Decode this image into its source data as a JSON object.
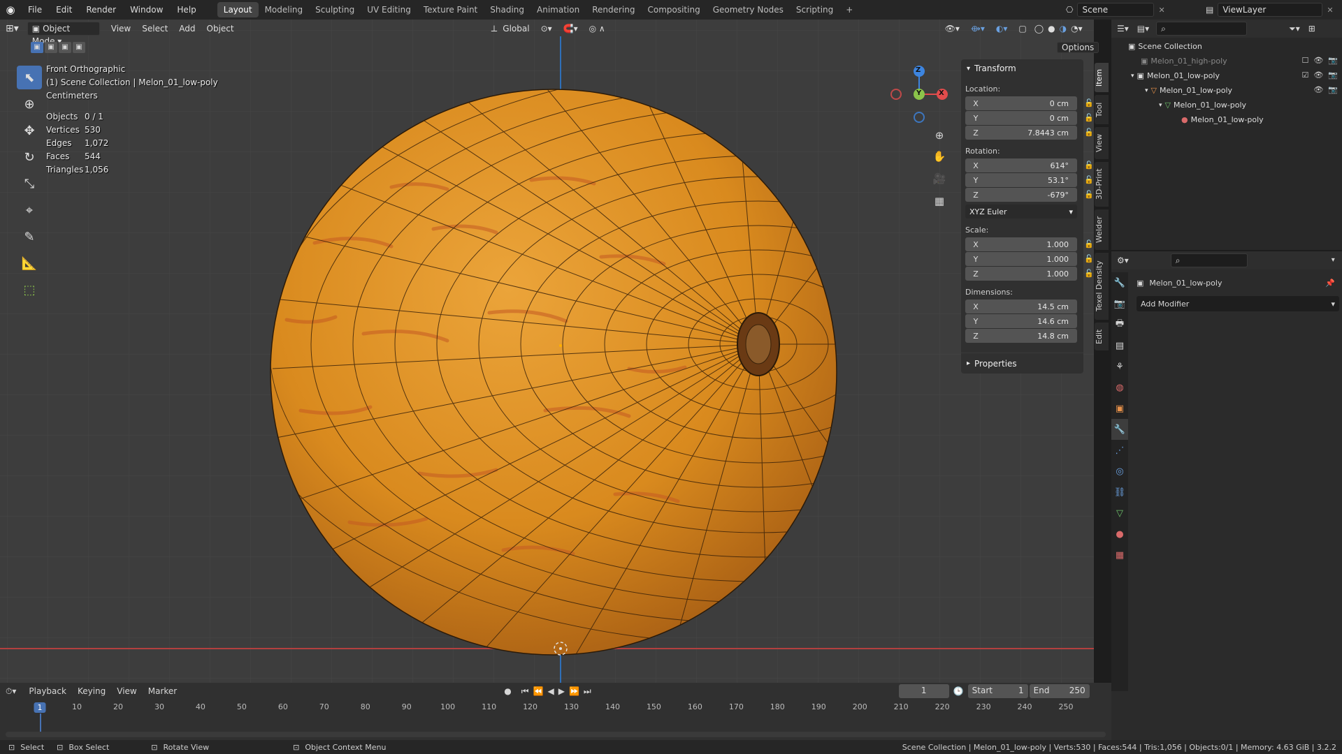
{
  "topbar": {
    "menus": [
      "File",
      "Edit",
      "Render",
      "Window",
      "Help"
    ],
    "workspaces": [
      "Layout",
      "Modeling",
      "Sculpting",
      "UV Editing",
      "Texture Paint",
      "Shading",
      "Animation",
      "Rendering",
      "Compositing",
      "Geometry Nodes",
      "Scripting"
    ],
    "active_workspace": "Layout",
    "add_tab": "+",
    "scene_name": "Scene",
    "view_layer": "ViewLayer"
  },
  "viewport_header": {
    "mode": "Object Mode",
    "menus": [
      "View",
      "Select",
      "Add",
      "Object"
    ],
    "transform_orientation": "Global",
    "options_label": "Options"
  },
  "overlay": {
    "view_name": "Front Orthographic",
    "collection_line": "(1) Scene Collection | Melon_01_low-poly",
    "units": "Centimeters",
    "stats": [
      {
        "key": "Objects",
        "value": "0 / 1"
      },
      {
        "key": "Vertices",
        "value": "530"
      },
      {
        "key": "Edges",
        "value": "1,072"
      },
      {
        "key": "Faces",
        "value": "544"
      },
      {
        "key": "Triangles",
        "value": "1,056"
      }
    ]
  },
  "gizmo": {
    "x": "X",
    "y": "Y",
    "z": "Z"
  },
  "npanel": {
    "transform_title": "Transform",
    "location_label": "Location:",
    "location": [
      {
        "axis": "X",
        "value": "0 cm"
      },
      {
        "axis": "Y",
        "value": "0 cm"
      },
      {
        "axis": "Z",
        "value": "7.8443 cm"
      }
    ],
    "rotation_label": "Rotation:",
    "rotation": [
      {
        "axis": "X",
        "value": "614°"
      },
      {
        "axis": "Y",
        "value": "53.1°"
      },
      {
        "axis": "Z",
        "value": "-679°"
      }
    ],
    "rotation_mode": "XYZ Euler",
    "scale_label": "Scale:",
    "scale": [
      {
        "axis": "X",
        "value": "1.000"
      },
      {
        "axis": "Y",
        "value": "1.000"
      },
      {
        "axis": "Z",
        "value": "1.000"
      }
    ],
    "dimensions_label": "Dimensions:",
    "dimensions": [
      {
        "axis": "X",
        "value": "14.5 cm"
      },
      {
        "axis": "Y",
        "value": "14.6 cm"
      },
      {
        "axis": "Z",
        "value": "14.8 cm"
      }
    ],
    "properties_title": "Properties"
  },
  "side_tabs": [
    "Item",
    "Tool",
    "View",
    "3D-Print",
    "Welder",
    "Texel Density",
    "Edit"
  ],
  "outliner": {
    "rows": [
      {
        "name": "Scene Collection",
        "indent": 0
      },
      {
        "name": "Melon_01_high-poly",
        "indent": 1
      },
      {
        "name": "Melon_01_low-poly",
        "indent": 1
      },
      {
        "name": "Melon_01_low-poly",
        "indent": 2
      },
      {
        "name": "Melon_01_low-poly",
        "indent": 3
      },
      {
        "name": "Melon_01_low-poly",
        "indent": 4
      }
    ]
  },
  "properties": {
    "object_name": "Melon_01_low-poly",
    "add_modifier": "Add Modifier"
  },
  "timeline": {
    "menus": [
      "Playback",
      "Keying",
      "View",
      "Marker"
    ],
    "current_frame": "1",
    "start_label": "Start",
    "start_value": "1",
    "end_label": "End",
    "end_value": "250",
    "ticks": [
      "1",
      "10",
      "20",
      "30",
      "40",
      "50",
      "60",
      "70",
      "80",
      "90",
      "100",
      "110",
      "120",
      "130",
      "140",
      "150",
      "160",
      "170",
      "180",
      "190",
      "200",
      "210",
      "220",
      "230",
      "240",
      "250"
    ]
  },
  "statusbar": {
    "select": "Select",
    "box_select": "Box Select",
    "rotate_view": "Rotate View",
    "context_menu": "Object Context Menu",
    "info": "Scene Collection | Melon_01_low-poly | Verts:530 | Faces:544 | Tris:1,056 | Objects:0/1 | Memory: 4.63 GiB | 3.2.2"
  },
  "colors": {
    "accent": "#4772b3",
    "melon_base": "#d98a1e",
    "melon_stripe": "#c45a22",
    "x_axis": "#e14c4c",
    "y_axis": "#8bc34a",
    "z_axis": "#3d85e0"
  }
}
